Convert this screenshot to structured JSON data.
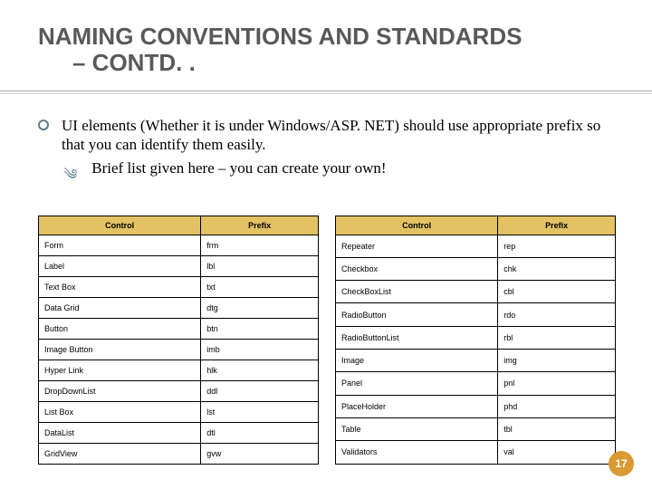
{
  "title": {
    "line1": "NAMING CONVENTIONS AND STANDARDS",
    "line2": "– CONTD. ."
  },
  "bullets": {
    "main": "UI elements (Whether it is under Windows/ASP. NET) should use appropriate prefix so that you can identify them easily.",
    "sub": "Brief list given here – you can create your own!"
  },
  "table_headers": {
    "control": "Control",
    "prefix": "Prefix"
  },
  "left_table": [
    {
      "control": "Form",
      "prefix": "frm"
    },
    {
      "control": "Label",
      "prefix": "lbl"
    },
    {
      "control": "Text Box",
      "prefix": "txt"
    },
    {
      "control": "Data Grid",
      "prefix": "dtg"
    },
    {
      "control": "Button",
      "prefix": "btn"
    },
    {
      "control": "Image Button",
      "prefix": "imb"
    },
    {
      "control": "Hyper Link",
      "prefix": "hlk"
    },
    {
      "control": "DropDownList",
      "prefix": "ddl"
    },
    {
      "control": "List Box",
      "prefix": "lst"
    },
    {
      "control": "DataList",
      "prefix": "dtl"
    },
    {
      "control": "GridView",
      "prefix": "gvw"
    }
  ],
  "right_table": [
    {
      "control": "Repeater",
      "prefix": "rep"
    },
    {
      "control": "Checkbox",
      "prefix": "chk"
    },
    {
      "control": "CheckBoxList",
      "prefix": "cbl"
    },
    {
      "control": "RadioButton",
      "prefix": "rdo"
    },
    {
      "control": "RadioButtonList",
      "prefix": "rbl"
    },
    {
      "control": "Image",
      "prefix": "img"
    },
    {
      "control": "Panel",
      "prefix": "pnl"
    },
    {
      "control": "PlaceHolder",
      "prefix": "phd"
    },
    {
      "control": "Table",
      "prefix": "tbl"
    },
    {
      "control": "Validators",
      "prefix": "val"
    }
  ],
  "page_number": "17"
}
